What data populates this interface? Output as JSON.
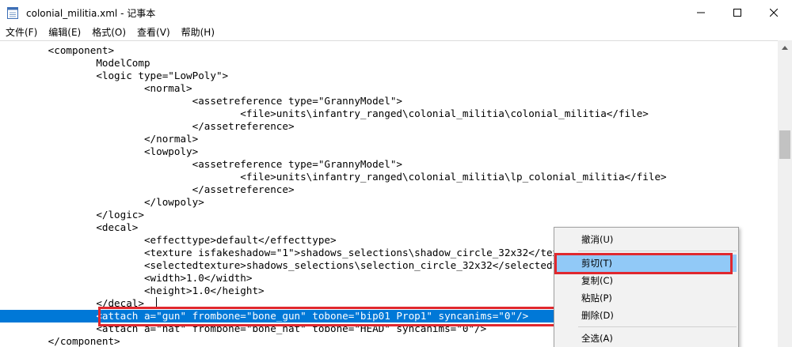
{
  "window": {
    "title": "colonial_militia.xml - 记事本"
  },
  "menu": {
    "items": [
      "文件(F)",
      "编辑(E)",
      "格式(O)",
      "查看(V)",
      "帮助(H)"
    ]
  },
  "editor": {
    "lines": [
      "        <component>",
      "                ModelComp",
      "                <logic type=\"LowPoly\">",
      "                        <normal>",
      "                                <assetreference type=\"GrannyModel\">",
      "                                        <file>units\\infantry_ranged\\colonial_militia\\colonial_militia</file>",
      "                                </assetreference>",
      "                        </normal>",
      "                        <lowpoly>",
      "                                <assetreference type=\"GrannyModel\">",
      "                                        <file>units\\infantry_ranged\\colonial_militia\\lp_colonial_militia</file>",
      "                                </assetreference>",
      "                        </lowpoly>",
      "                </logic>",
      "                <decal>",
      "                        <effecttype>default</effecttype>",
      "                        <texture isfakeshadow=\"1\">shadows_selections\\shadow_circle_32x32</texture>",
      "                        <selectedtexture>shadows_selections\\selection_circle_32x32</selectedtexture>",
      "                        <width>1.0</width>",
      "                        <height>1.0</height>",
      "                </decal>",
      "                <attach a=\"gun\" frombone=\"bone_gun\" tobone=\"bip01 Prop1\" syncanims=\"0\"/>",
      "                <attach a=\"hat\" frombone=\"bone_hat\" tobone=\"HEAD\" syncanims=\"0\"/>",
      "        </component>"
    ]
  },
  "context_menu": {
    "items": [
      {
        "label": "撤消(U)"
      },
      {
        "label": "剪切(T)"
      },
      {
        "label": "复制(C)"
      },
      {
        "label": "粘贴(P)"
      },
      {
        "label": "删除(D)"
      },
      {
        "label": "全选(A)"
      }
    ]
  },
  "colors": {
    "selection": "#0078d7",
    "highlight_box": "#e0282e",
    "menu_hover": "#91c9f7"
  }
}
